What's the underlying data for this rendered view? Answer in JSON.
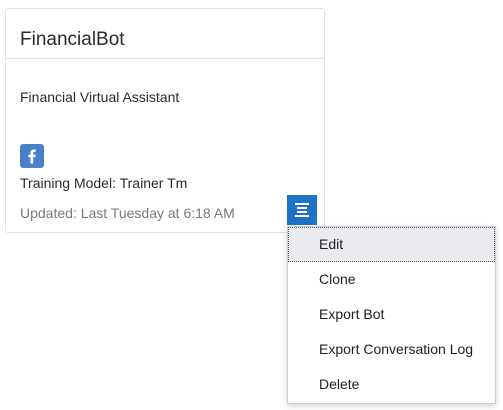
{
  "bot_card": {
    "title": "FinancialBot",
    "description": "Financial Virtual Assistant",
    "channel_icon": "facebook-icon",
    "training_model": "Training Model: Trainer Tm",
    "updated": "Updated: Last Tuesday at 6:18 AM"
  },
  "menu_button": {
    "icon": "menu-lines-icon"
  },
  "dropdown": {
    "items": [
      {
        "label": "Edit"
      },
      {
        "label": "Clone"
      },
      {
        "label": "Export Bot"
      },
      {
        "label": "Export Conversation Log"
      },
      {
        "label": "Delete"
      }
    ]
  },
  "colors": {
    "accent": "#1f73c7",
    "facebook": "#4a80c8",
    "hover": "#e9ebee",
    "muted_text": "#7a7a7a"
  }
}
